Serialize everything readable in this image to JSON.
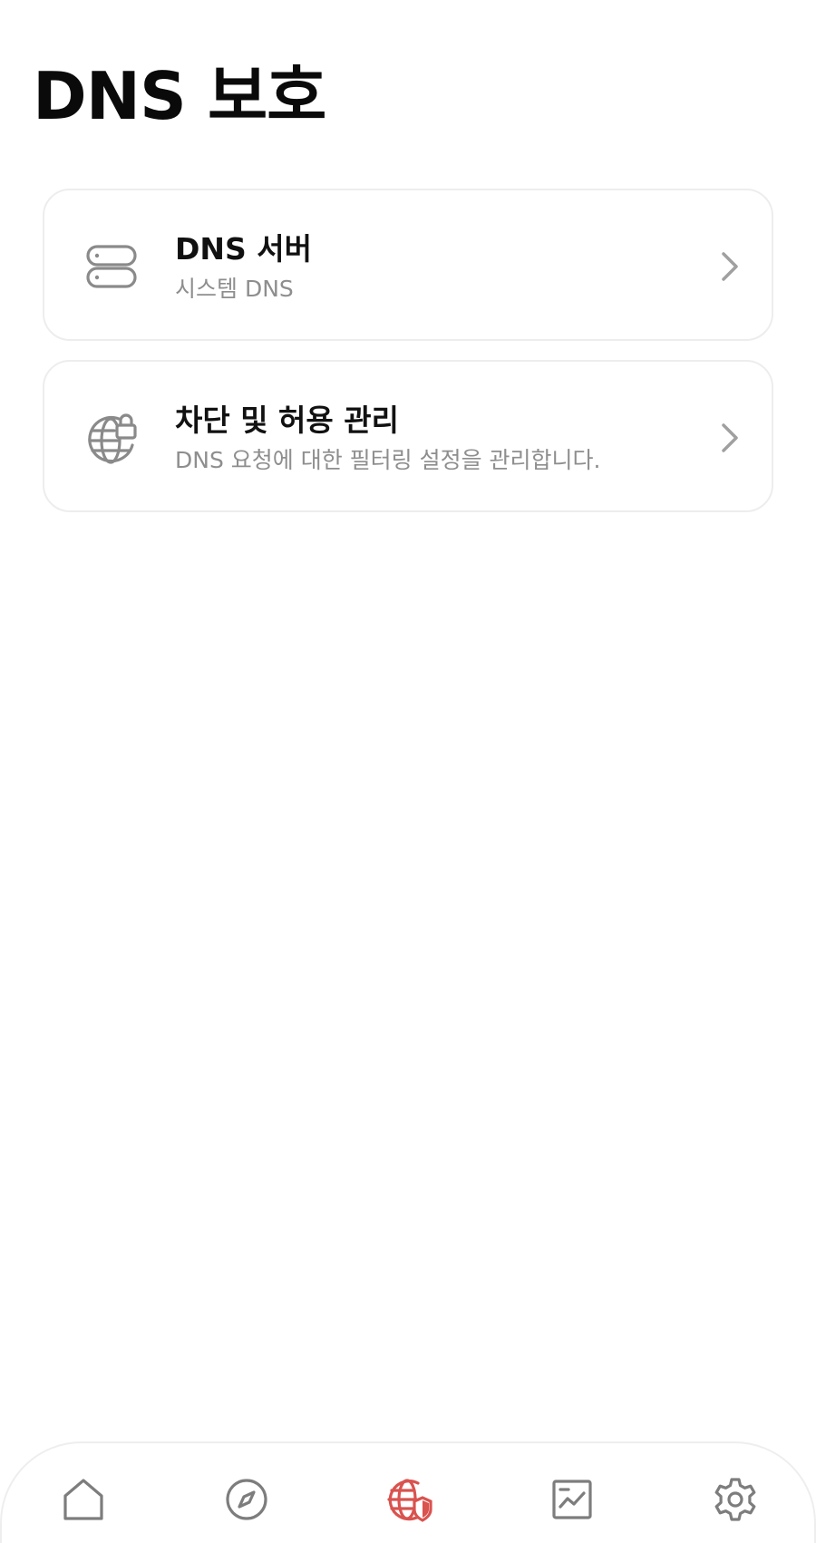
{
  "page": {
    "title": "DNS 보호"
  },
  "cards": [
    {
      "title": "DNS 서버",
      "subtitle": "시스템 DNS",
      "icon": "server-icon"
    },
    {
      "title": "차단 및 허용 관리",
      "subtitle": "DNS 요청에 대한 필터링 설정을 관리합니다.",
      "icon": "globe-lock-icon"
    }
  ],
  "tabbar": {
    "active_index": 2,
    "active_color": "#d9534f",
    "inactive_color": "#7d7d7d",
    "items": [
      {
        "name": "home",
        "icon": "home-icon"
      },
      {
        "name": "explore",
        "icon": "compass-icon"
      },
      {
        "name": "dns-protection",
        "icon": "globe-shield-icon"
      },
      {
        "name": "statistics",
        "icon": "chart-icon"
      },
      {
        "name": "settings",
        "icon": "gear-icon"
      }
    ]
  }
}
